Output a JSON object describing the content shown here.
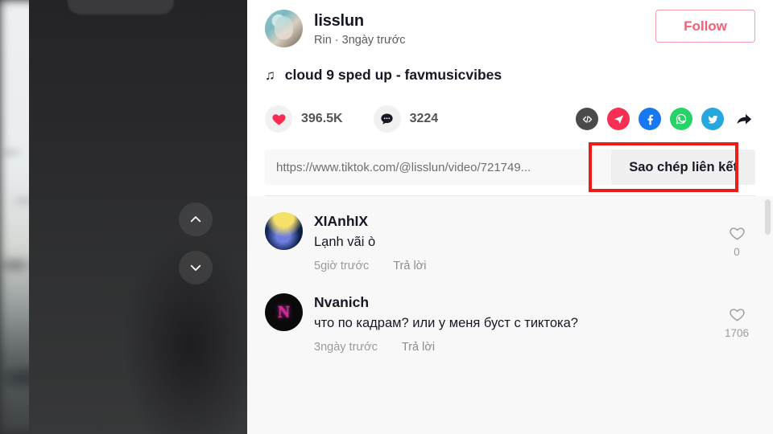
{
  "video": {
    "nav_up_label": "chevron-up",
    "nav_down_label": "chevron-down"
  },
  "header": {
    "author_name": "lisslun",
    "author_subtitle": "Rin · 3ngày trước",
    "follow_label": "Follow",
    "avatar_name": "lisslun-avatar",
    "follow_border_color": "#f0a0ae",
    "follow_text_color": "#f2607a"
  },
  "music": {
    "icon": "♫",
    "title": "cloud 9 sped up - favmusicvibes"
  },
  "stats": {
    "like_count": "396.5K",
    "comment_count": "3224",
    "like_color": "#fe2c55",
    "share": [
      {
        "name": "embed-code-icon",
        "glyph": "</>",
        "color": "#4a4a4a"
      },
      {
        "name": "send-icon",
        "glyph": "➤",
        "color": "#f72f53"
      },
      {
        "name": "facebook-icon",
        "glyph": "f",
        "color": "#1778f2"
      },
      {
        "name": "whatsapp-icon",
        "glyph": "✆",
        "color": "#25d366"
      },
      {
        "name": "twitter-icon",
        "glyph": "🐦",
        "color": "#26a7de"
      },
      {
        "name": "share-arrow-icon",
        "glyph": "➜",
        "color": "#161823"
      }
    ]
  },
  "link": {
    "url": "https://www.tiktok.com/@lisslun/video/721749...",
    "copy_label": "Sao chép liên kết",
    "annotation_color": "#ee1c16"
  },
  "comments": [
    {
      "name": "XIAnhIX",
      "text": "Lạnh vãi ò",
      "time": "5giờ trước",
      "reply_label": "Trả lời",
      "likes": "0",
      "avatar_name": "xianhix-avatar"
    },
    {
      "name": "Nvanich",
      "text": "что по кадрам? или у меня буст с тиктока?",
      "time": "3ngày trước",
      "reply_label": "Trả lời",
      "likes": "1706",
      "avatar_name": "nvanich-avatar"
    }
  ]
}
